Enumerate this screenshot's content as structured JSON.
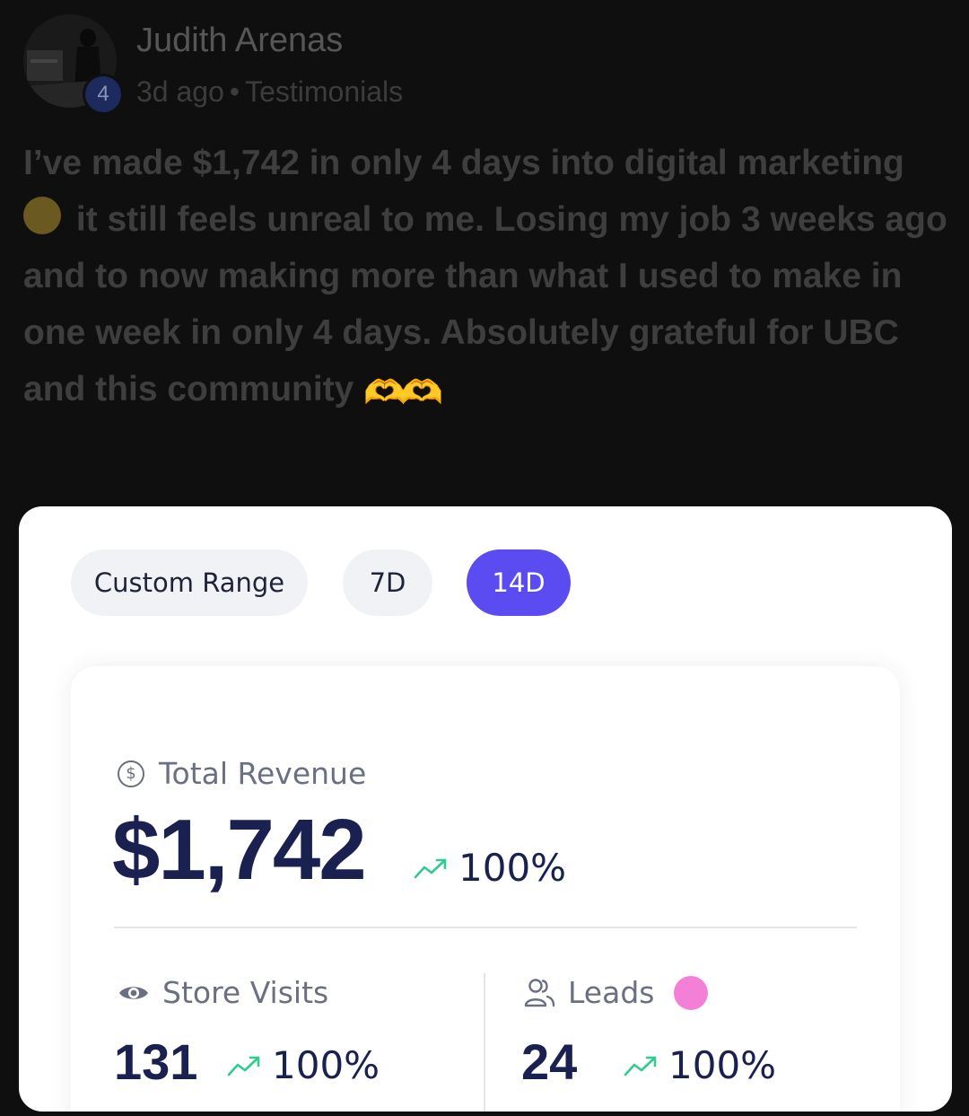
{
  "post": {
    "author": "Judith Arenas",
    "level": "4",
    "time_ago": "3d ago",
    "separator": "•",
    "category": "Testimonials",
    "body_part1": "I’ve made $1,742 in only 4 days into digital marketing ",
    "body_part2": " it still feels unreal to me. Losing my job 3 weeks ago and to now making more than what I used to make in one week in only 4 days. Absolutely grateful for UBC and this community ",
    "emoji_end": "🫶🫶"
  },
  "filters": {
    "custom_range": "Custom Range",
    "seven_day": "7D",
    "fourteen_day": "14D",
    "active": "14D"
  },
  "stats": {
    "revenue_label": "Total Revenue",
    "revenue_icon_glyph": "$",
    "revenue_value": "$1,742",
    "revenue_change": "100%",
    "visits_label": "Store Visits",
    "visits_value": "131",
    "visits_change": "100%",
    "leads_label": "Leads",
    "leads_value": "24",
    "leads_change": "100%"
  },
  "colors": {
    "active_pill": "#5b4cf2",
    "trend_up": "#2ecc8f",
    "value_text": "#1a2151",
    "leads_dot": "#f47fd6"
  }
}
